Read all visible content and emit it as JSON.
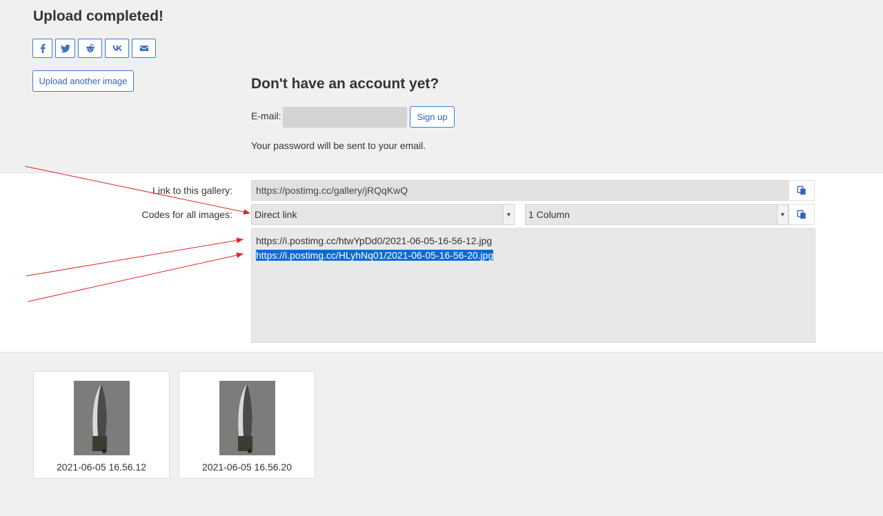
{
  "header": {
    "title": "Upload completed!"
  },
  "share": [
    {
      "icon": "facebook-icon"
    },
    {
      "icon": "twitter-icon"
    },
    {
      "icon": "reddit-icon"
    },
    {
      "icon": "vk-icon"
    },
    {
      "icon": "email-icon"
    }
  ],
  "actions": {
    "upload_another": "Upload another image"
  },
  "account": {
    "title": "Don't have an account yet?",
    "email_label": "E-mail:",
    "email_value": "",
    "signup_label": "Sign up",
    "password_note": "Your password will be sent to your email."
  },
  "codes": {
    "gallery_label": "Link to this gallery:",
    "gallery_url": "https://postimg.cc/gallery/jRQqKwQ",
    "codes_label": "Codes for all images:",
    "format_selected": "Direct link",
    "layout_selected": "1 Column",
    "lines": [
      "https://i.postimg.cc/htwYpDd0/2021-06-05-16-56-12.jpg",
      "https://i.postimg.cc/HLyhNq01/2021-06-05-16-56-20.jpg"
    ]
  },
  "thumbnails": [
    {
      "caption": "2021-06-05 16.56.12"
    },
    {
      "caption": "2021-06-05 16.56.20"
    }
  ],
  "colors": {
    "accent": "#3a7bd5",
    "annotation_arrow": "#d9262b",
    "selection": "#0a6bd6"
  }
}
